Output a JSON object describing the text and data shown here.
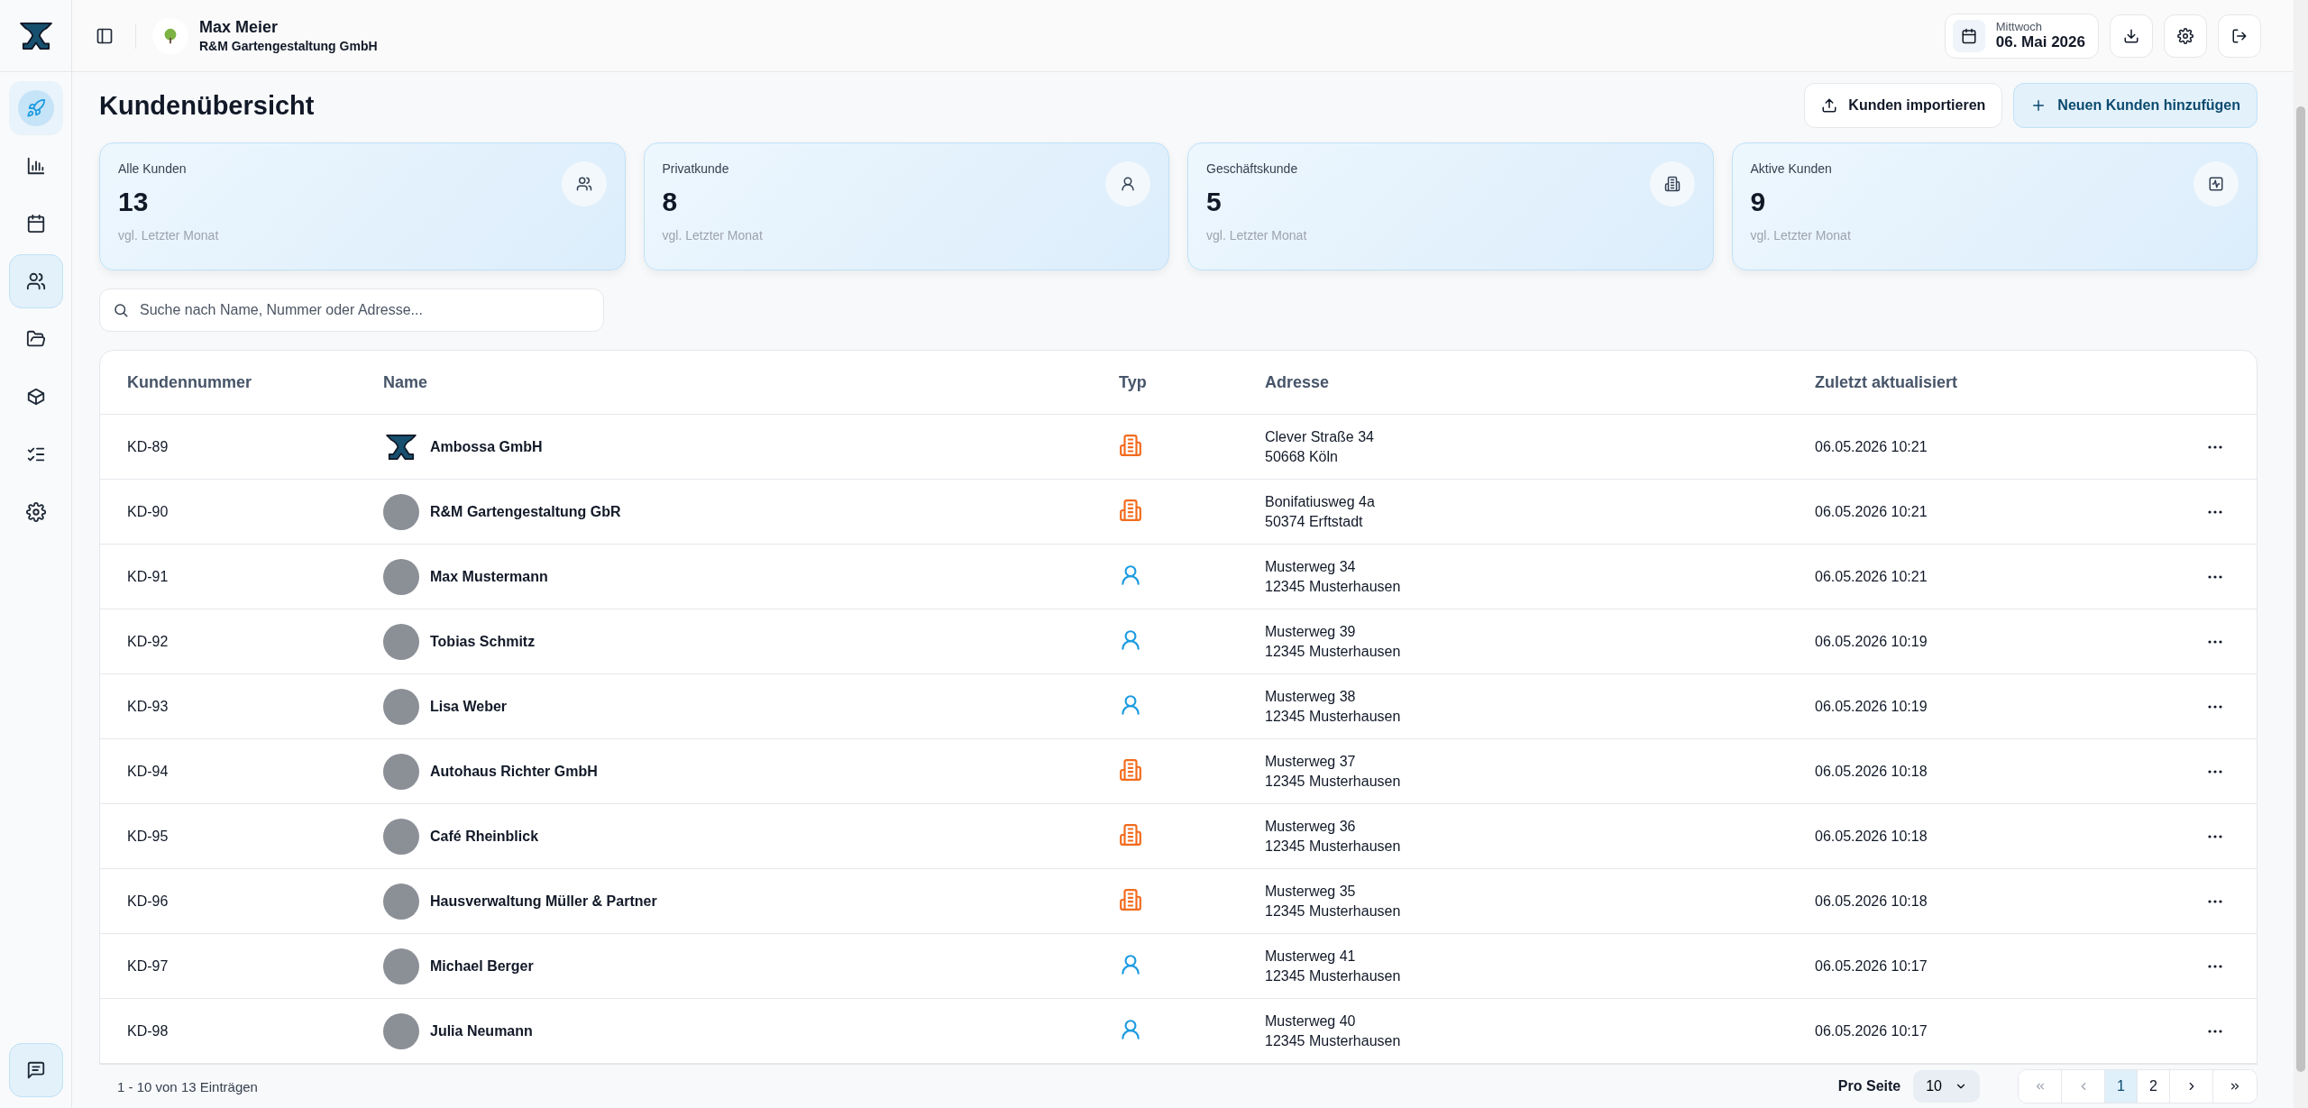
{
  "user": {
    "name": "Max Meier",
    "company": "R&M Gartengestaltung GmbH"
  },
  "date": {
    "weekday": "Mittwoch",
    "date": "06. Mai 2026"
  },
  "sidebar": {
    "items": [
      {
        "selected": false
      },
      {
        "selected": false
      },
      {
        "selected": false
      },
      {
        "selected": true
      },
      {
        "selected": false
      },
      {
        "selected": false
      },
      {
        "selected": false
      },
      {
        "selected": false
      }
    ]
  },
  "page": {
    "title": "Kundenübersicht",
    "actions": [
      {
        "label": "Kunden importieren",
        "kind": "secondary"
      },
      {
        "label": "Neuen Kunden hinzufügen",
        "kind": "primary"
      }
    ]
  },
  "stats": [
    {
      "label": "Alle Kunden",
      "value": "13",
      "note": "vgl. Letzter Monat"
    },
    {
      "label": "Privatkunde",
      "value": "8",
      "note": "vgl. Letzter Monat"
    },
    {
      "label": "Geschäftskunde",
      "value": "5",
      "note": "vgl. Letzter Monat"
    },
    {
      "label": "Aktive Kunden",
      "value": "9",
      "note": "vgl. Letzter Monat"
    }
  ],
  "search": {
    "placeholder": "Suche nach Name, Nummer oder Adresse..."
  },
  "table": {
    "columns": [
      "Kundennummer",
      "Name",
      "Typ",
      "Adresse",
      "Zuletzt aktualisiert"
    ],
    "rows": [
      {
        "number": "KD-89",
        "name": "Ambossa GmbH",
        "kind": "business",
        "street": "Clever Straße 34",
        "city": "50668 Köln",
        "updated": "06.05.2026 10:21"
      },
      {
        "number": "KD-90",
        "name": "R&M Gartengestaltung GbR",
        "kind": "business",
        "street": "Bonifatiusweg 4a",
        "city": "50374 Erftstadt",
        "updated": "06.05.2026 10:21"
      },
      {
        "number": "KD-91",
        "name": "Max Mustermann",
        "kind": "person",
        "street": "Musterweg 34",
        "city": "12345 Musterhausen",
        "updated": "06.05.2026 10:21"
      },
      {
        "number": "KD-92",
        "name": "Tobias Schmitz",
        "kind": "person",
        "street": "Musterweg 39",
        "city": "12345 Musterhausen",
        "updated": "06.05.2026 10:19"
      },
      {
        "number": "KD-93",
        "name": "Lisa Weber",
        "kind": "person",
        "street": "Musterweg 38",
        "city": "12345 Musterhausen",
        "updated": "06.05.2026 10:19"
      },
      {
        "number": "KD-94",
        "name": "Autohaus Richter GmbH",
        "kind": "business",
        "street": "Musterweg 37",
        "city": "12345 Musterhausen",
        "updated": "06.05.2026 10:18"
      },
      {
        "number": "KD-95",
        "name": "Café Rheinblick",
        "kind": "business",
        "street": "Musterweg 36",
        "city": "12345 Musterhausen",
        "updated": "06.05.2026 10:18"
      },
      {
        "number": "KD-96",
        "name": "Hausverwaltung Müller & Partner",
        "kind": "business",
        "street": "Musterweg 35",
        "city": "12345 Musterhausen",
        "updated": "06.05.2026 10:18"
      },
      {
        "number": "KD-97",
        "name": "Michael Berger",
        "kind": "person",
        "street": "Musterweg 41",
        "city": "12345 Musterhausen",
        "updated": "06.05.2026 10:17"
      },
      {
        "number": "KD-98",
        "name": "Julia Neumann",
        "kind": "person",
        "street": "Musterweg 40",
        "city": "12345 Musterhausen",
        "updated": "06.05.2026 10:17"
      }
    ]
  },
  "footer": {
    "summary": "1 - 10 von 13 Einträgen",
    "per_page_label": "Pro Seite",
    "per_page": "10",
    "pages": [
      {
        "label": "1",
        "selected": true
      },
      {
        "label": "2",
        "selected": false
      }
    ]
  }
}
